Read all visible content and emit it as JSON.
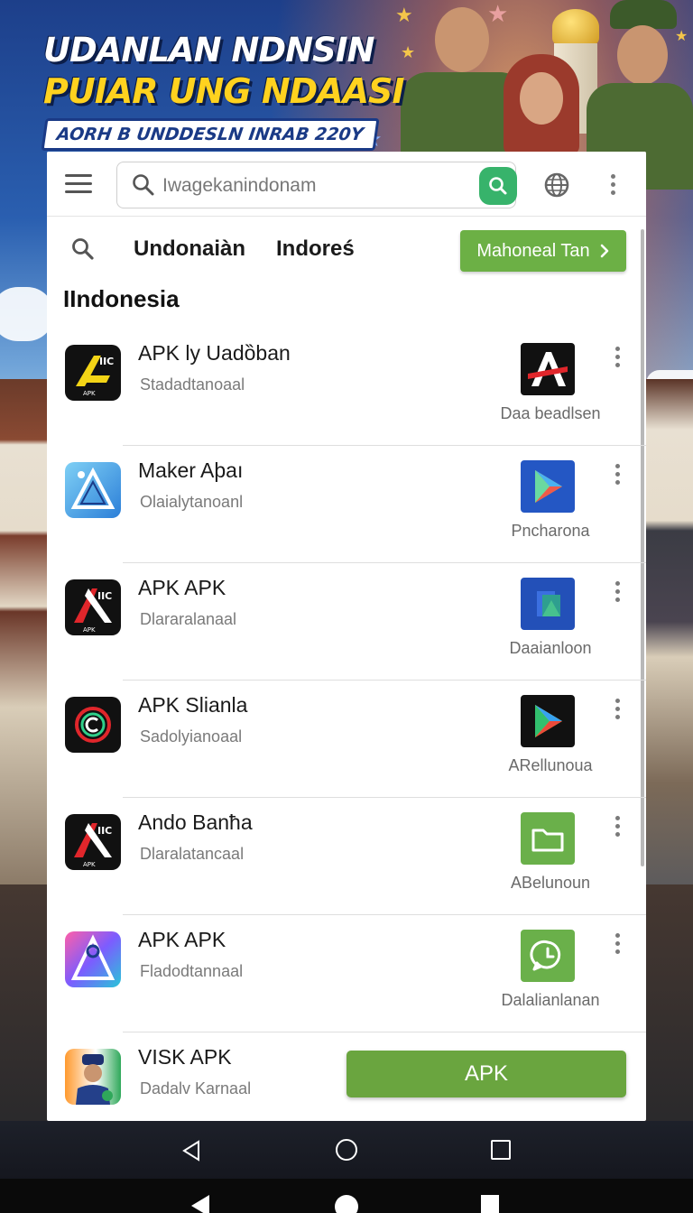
{
  "banner": {
    "line1": "UDANLAN NDNSIN",
    "line2": "PUIAR UNG NDAASI",
    "subtitle": "AORH B UNDDESLN INRAB 220Y"
  },
  "topbar": {
    "search_placeholder": "Iwagekanindonam",
    "icons": [
      "menu-icon",
      "search-icon",
      "globe-icon",
      "more-vert-icon"
    ]
  },
  "subnav": {
    "tabs": [
      "Undonaiàn",
      "Indoreś"
    ],
    "action_button": "Mahoneal Tan"
  },
  "section_title": "IIndonesia",
  "apps": [
    {
      "name": "APK ly Uadȍban",
      "subtitle": "Stadadtanoaal",
      "right_label": "Daa beadlsen",
      "left_icon": "apk-logo-yellow",
      "right_icon": "red-a-logo"
    },
    {
      "name": "Maker Aþaı",
      "subtitle": "Olaialytanoanl",
      "right_label": "Pncharona",
      "left_icon": "blue-a-logo",
      "right_icon": "play-store-logo"
    },
    {
      "name": "APK APK",
      "subtitle": "Dlararalanaal",
      "right_label": "Daaianloon",
      "left_icon": "apk-logo-red",
      "right_icon": "files-logo"
    },
    {
      "name": "APK Slianla",
      "subtitle": "Sadolyianoaal",
      "right_label": "ARellunoua",
      "left_icon": "c-ring-logo",
      "right_icon": "play-store-logo-dark"
    },
    {
      "name": "Ando Banħa",
      "subtitle": "Dlaralatancaal",
      "right_label": "ABelunoun",
      "left_icon": "apk-logo-red",
      "right_icon": "folder-logo"
    },
    {
      "name": "APK APK",
      "subtitle": "Fladodtannaal",
      "right_label": "Dalalianlanan",
      "left_icon": "gradient-a-logo",
      "right_icon": "whatsapp-logo"
    },
    {
      "name": "VISK APK",
      "subtitle": "Dadalv Karnaal",
      "right_label": "",
      "left_icon": "police-avatar",
      "right_icon": ""
    }
  ],
  "apk_button": "APK",
  "colors": {
    "accent_green": "#6cb045",
    "search_green": "#37b36b",
    "banner_yellow": "#ffd21f",
    "banner_navy": "#1a3a86"
  }
}
